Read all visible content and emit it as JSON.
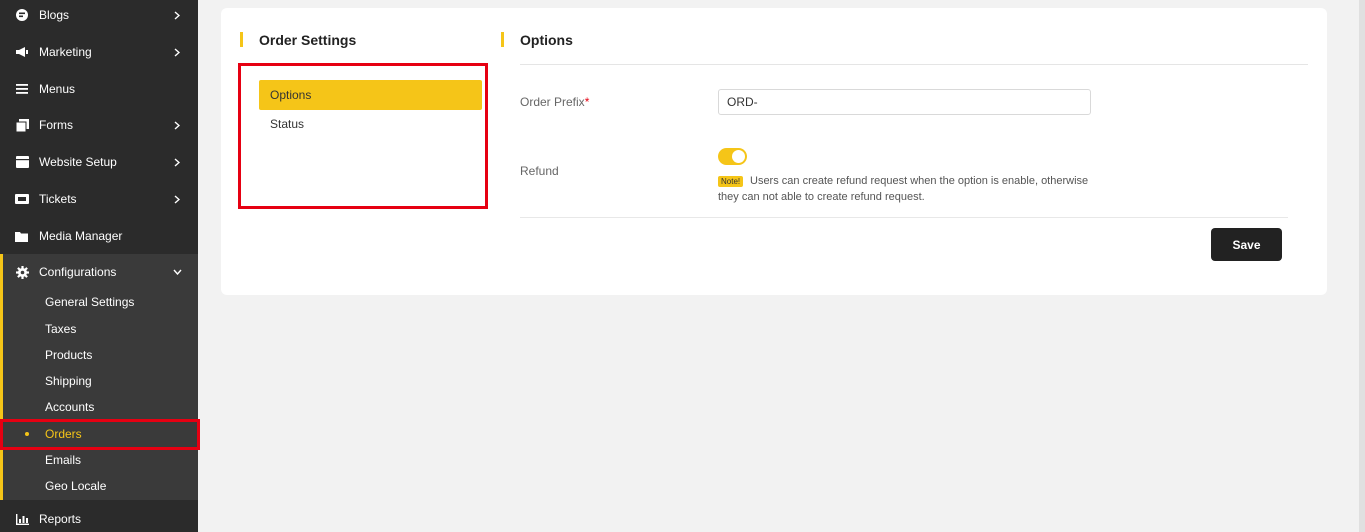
{
  "sidebar": {
    "items": [
      {
        "label": "Blogs",
        "icon": "blog-icon",
        "has_children": true
      },
      {
        "label": "Marketing",
        "icon": "megaphone-icon",
        "has_children": true
      },
      {
        "label": "Menus",
        "icon": "menu-lines-icon",
        "has_children": false
      },
      {
        "label": "Forms",
        "icon": "forms-icon",
        "has_children": true
      },
      {
        "label": "Website Setup",
        "icon": "website-icon",
        "has_children": true
      },
      {
        "label": "Tickets",
        "icon": "ticket-icon",
        "has_children": true
      },
      {
        "label": "Media Manager",
        "icon": "folder-icon",
        "has_children": false
      },
      {
        "label": "Configurations",
        "icon": "gear-icon",
        "expanded": true
      },
      {
        "label": "Reports",
        "icon": "bar-chart-icon",
        "has_children": false
      }
    ],
    "config_children": [
      {
        "label": "General Settings"
      },
      {
        "label": "Taxes"
      },
      {
        "label": "Products"
      },
      {
        "label": "Shipping"
      },
      {
        "label": "Accounts"
      },
      {
        "label": "Orders",
        "active": true
      },
      {
        "label": "Emails"
      },
      {
        "label": "Geo Locale"
      }
    ]
  },
  "main": {
    "left_title": "Order Settings",
    "right_title": "Options",
    "tabs": [
      {
        "label": "Options",
        "active": true
      },
      {
        "label": "Status"
      }
    ],
    "fields": {
      "order_prefix_label": "Order Prefix",
      "required_mark": "*",
      "order_prefix_value": "ORD-",
      "refund_label": "Refund",
      "refund_enabled": true,
      "note_badge": "Note!",
      "note_text": "Users can create refund request when the option is enable, otherwise they can not able to create refund request."
    },
    "save_label": "Save"
  },
  "colors": {
    "accent": "#f5c518",
    "sidebar_bg": "#2b2b2b",
    "highlight_border": "#e60012"
  }
}
